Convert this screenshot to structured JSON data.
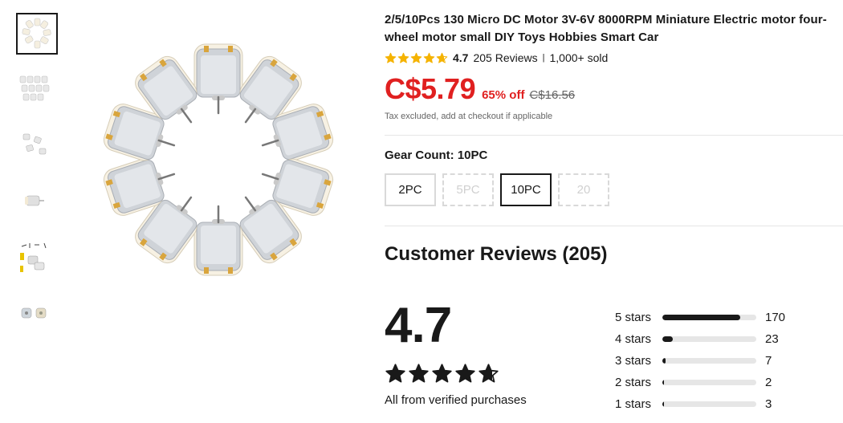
{
  "product": {
    "title": "2/5/10Pcs 130 Micro DC Motor 3V-6V 8000RPM Miniature Electric motor four-wheel motor small DIY Toys Hobbies Smart Car",
    "rating": "4.7",
    "reviews_link": "205 Reviews",
    "separator": "|",
    "sold": "1,000+ sold",
    "price": "C$5.79",
    "discount": "65% off",
    "original_price": "C$16.56",
    "tax_note": "Tax excluded, add at checkout if applicable",
    "star_color": "#f5b301"
  },
  "gear": {
    "label": "Gear Count: 10PC",
    "options": [
      {
        "label": "2PC",
        "state": "available"
      },
      {
        "label": "5PC",
        "state": "disabled"
      },
      {
        "label": "10PC",
        "state": "selected"
      },
      {
        "label": "20",
        "state": "disabled"
      }
    ]
  },
  "reviews": {
    "title": "Customer Reviews (205)",
    "average": "4.7",
    "verified_note": "All from verified purchases",
    "histogram": [
      {
        "label": "5 stars",
        "count": "170",
        "fraction": 0.83
      },
      {
        "label": "4 stars",
        "count": "23",
        "fraction": 0.11
      },
      {
        "label": "3 stars",
        "count": "7",
        "fraction": 0.035
      },
      {
        "label": "2 stars",
        "count": "2",
        "fraction": 0.01
      },
      {
        "label": "1 stars",
        "count": "3",
        "fraction": 0.015
      }
    ]
  },
  "thumbnails": [
    {
      "name": "motor-ring",
      "active": true
    },
    {
      "name": "motor-rows",
      "active": false
    },
    {
      "name": "motor-scatter",
      "active": false
    },
    {
      "name": "single-motor",
      "active": false
    },
    {
      "name": "motor-kit",
      "active": false
    },
    {
      "name": "motor-pair",
      "active": false
    }
  ],
  "colors": {
    "price_red": "#e02020",
    "text": "#191919",
    "muted": "#666666",
    "border": "#d9d9d9"
  }
}
